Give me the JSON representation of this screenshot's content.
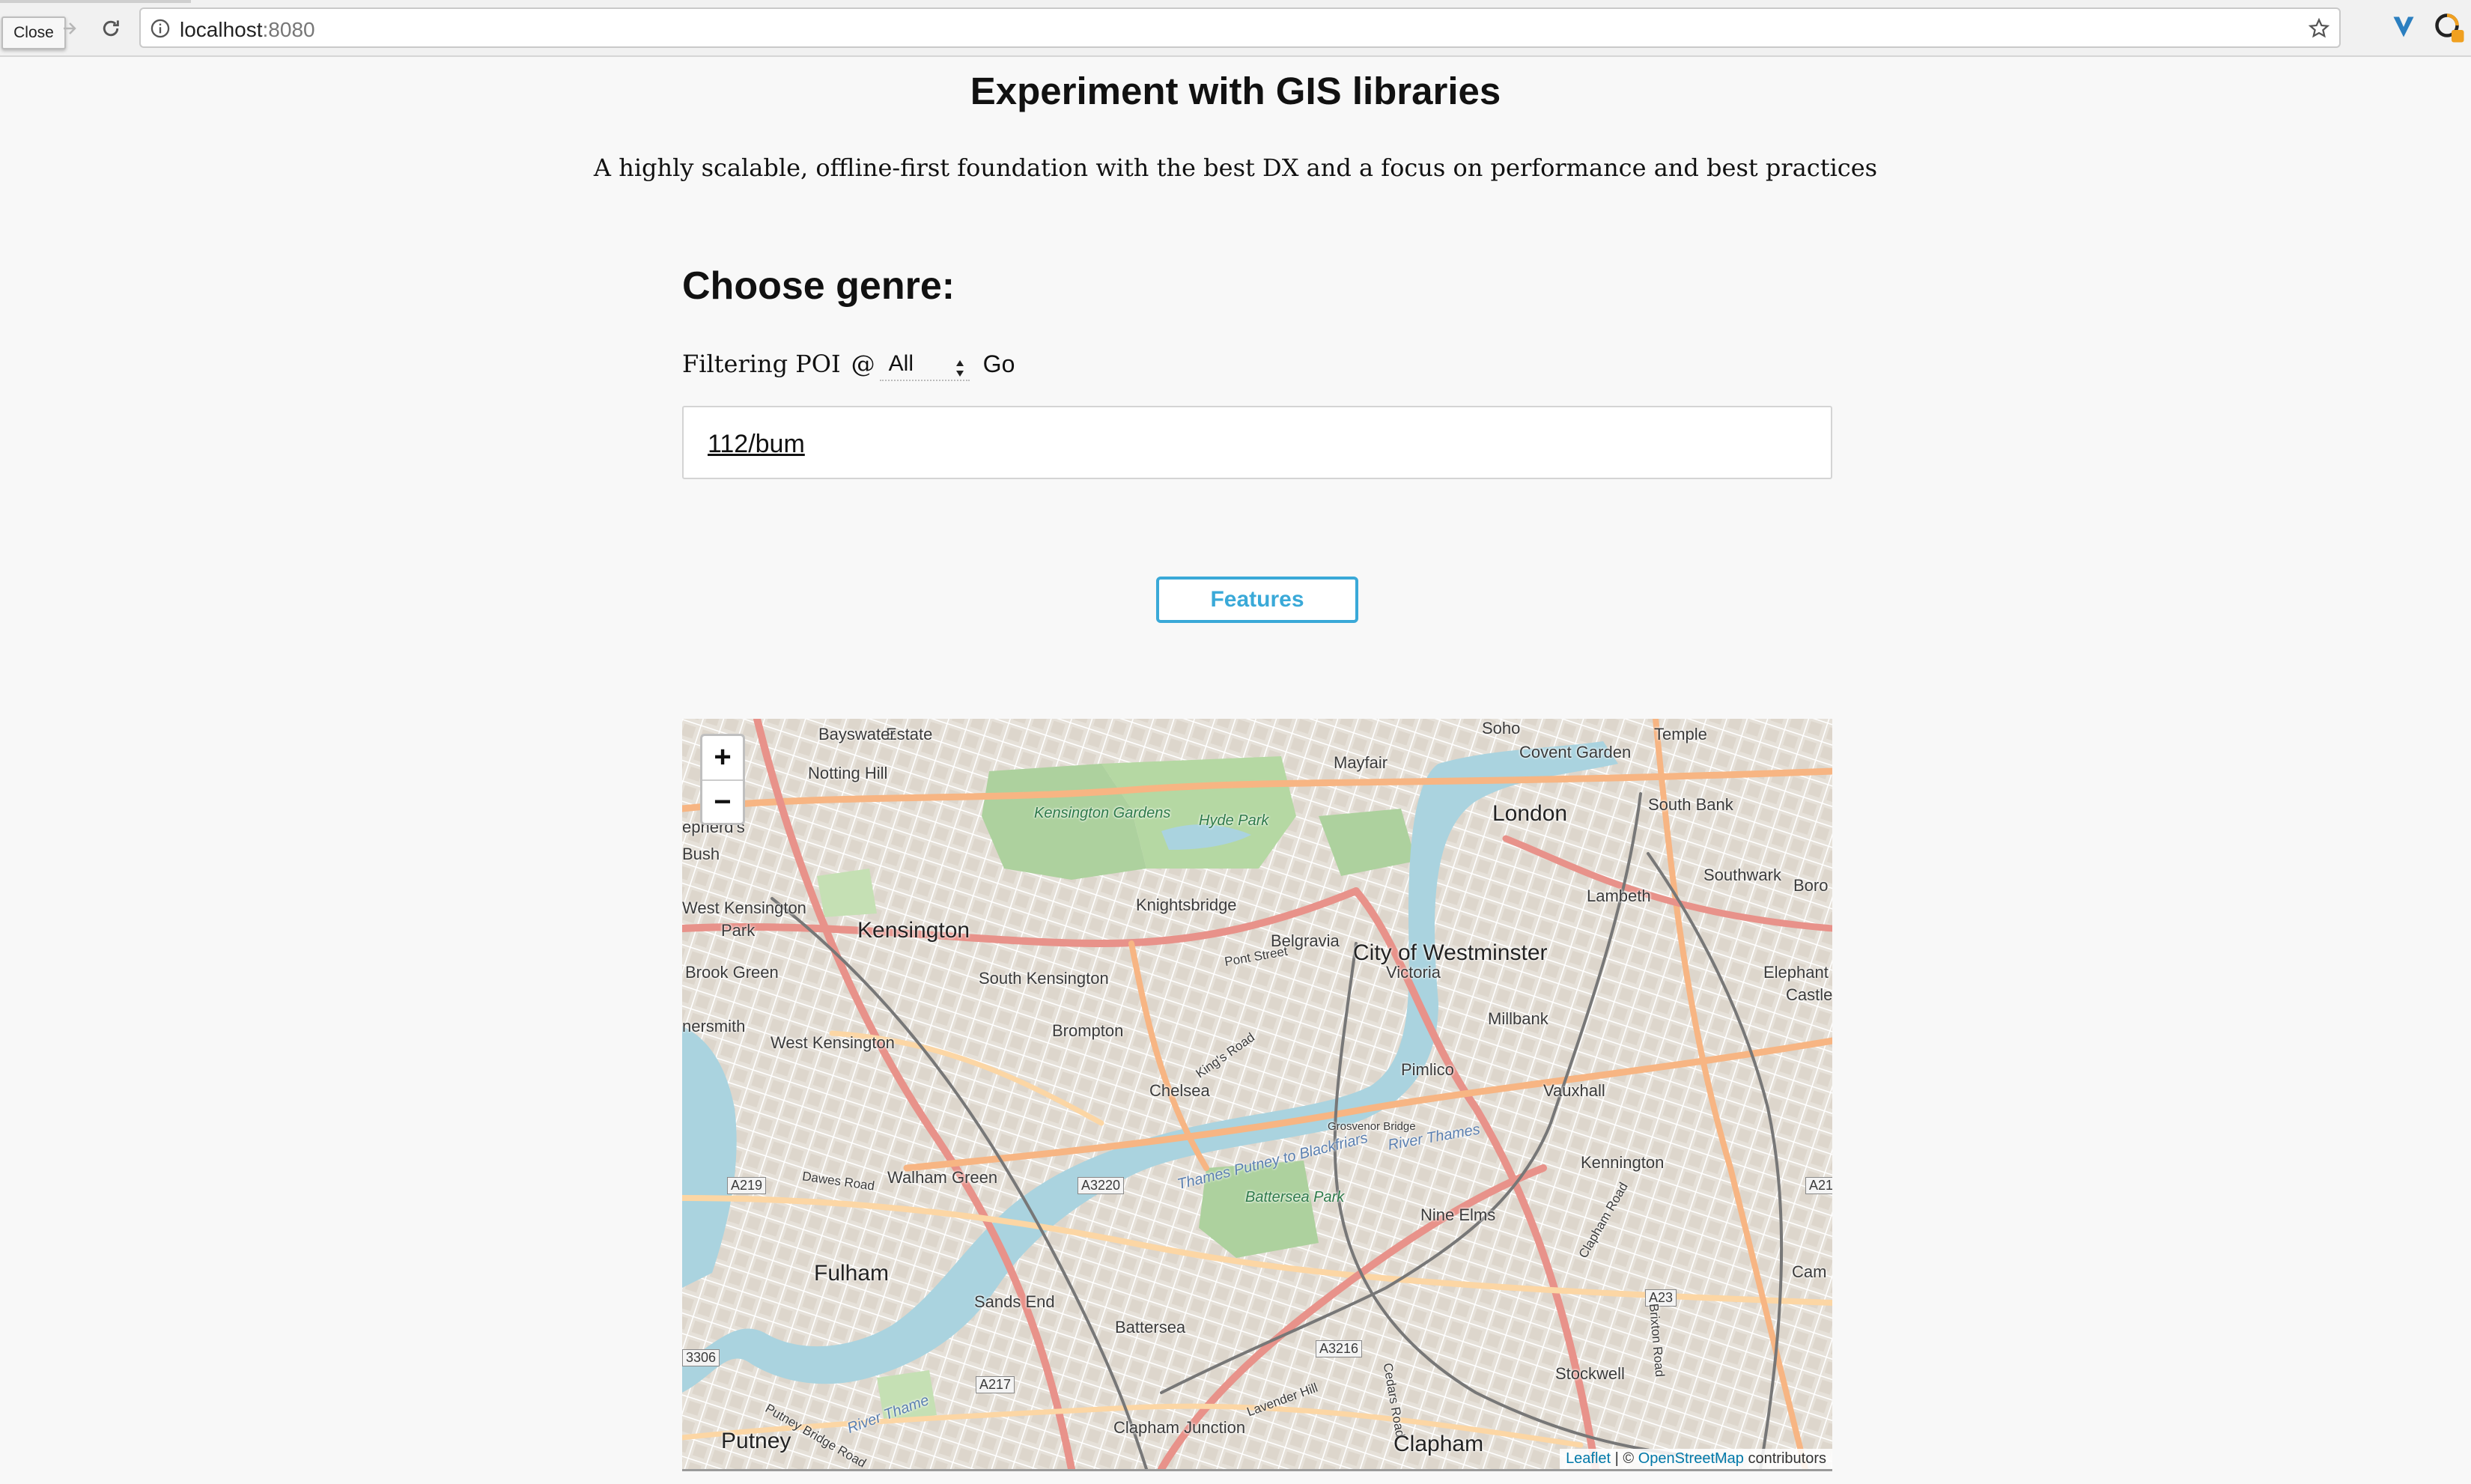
{
  "browser": {
    "tooltip": "Close",
    "url_host": "localhost",
    "url_port": ":8080"
  },
  "page": {
    "title": "Experiment with GIS libraries",
    "subtitle": "A highly scalable, offline-first foundation with the best DX and a focus on performance and best practices",
    "genre_heading": "Choose genre:"
  },
  "filter": {
    "label": "Filtering POI",
    "at": "@",
    "selected": "All",
    "go_label": "Go"
  },
  "search": {
    "value": "112/bum"
  },
  "features_button": "Features",
  "map": {
    "zoom_in": "+",
    "zoom_out": "−",
    "attribution": {
      "leaflet": "Leaflet",
      "separator": " | © ",
      "osm": "OpenStreetMap",
      "suffix": " contributors"
    },
    "labels": {
      "bayswater": "Bayswater",
      "notting_hill": "Notting Hill",
      "soho": "Soho",
      "temple": "Temple",
      "covent_garden": "Covent Garden",
      "mayfair": "Mayfair",
      "london": "London",
      "kensington_gardens": "Kensington Gardens",
      "hyde_park": "Hyde Park",
      "south_bank": "South Bank",
      "shepherds_bush_a": "epherd's",
      "shepherds_bush_b": "Bush",
      "southwark": "Southwark",
      "borough": "Boro",
      "knightsbridge": "Knightsbridge",
      "lambeth": "Lambeth",
      "west_kensington_park_a": "West Kensington",
      "west_kensington_park_b": "Park",
      "kensington": "Kensington",
      "belgravia": "Belgravia",
      "pont_street": "Pont Street",
      "city_of_westminster": "City of Westminster",
      "victoria": "Victoria",
      "brook_green": "Brook Green",
      "south_kensington": "South Kensington",
      "elephant_castle_a": "Elephant and",
      "elephant_castle_b": "Castle",
      "hammersmith": "nersmith",
      "west_kensington": "West Kensington",
      "brompton": "Brompton",
      "millbank": "Millbank",
      "kings_road": "King's Road",
      "pimlico": "Pimlico",
      "chelsea": "Chelsea",
      "vauxhall": "Vauxhall",
      "grosvenor_bridge": "Grosvenor Bridge",
      "river_thames": "River Thames",
      "kennington": "Kennington",
      "a219": "A219",
      "dawes_road": "Dawes Road",
      "walham_green": "Walham Green",
      "a3220": "A3220",
      "thames_path": "Thames Putney to Blackfriars",
      "battersea_park": "Battersea Park",
      "nine_elms": "Nine Elms",
      "clapham_road": "Clapham Road",
      "fulham": "Fulham",
      "sands_end": "Sands End",
      "a23": "A23",
      "camberwell": "Cam",
      "battersea": "Battersea",
      "a3216": "A3216",
      "brixton_road": "Brixton Road",
      "stockwell": "Stockwell",
      "a3306": "3306",
      "a217": "A217",
      "river_thame_2": "River Thame",
      "lavender_hill": "Lavender Hill",
      "clapham_junction": "Clapham Junction",
      "putney": "Putney",
      "clapham": "Clapham",
      "putney_bridge_road": "Putney Bridge Road",
      "cedars_road": "Cedars Road",
      "a21": "A21",
      "estate": "Estate"
    }
  }
}
